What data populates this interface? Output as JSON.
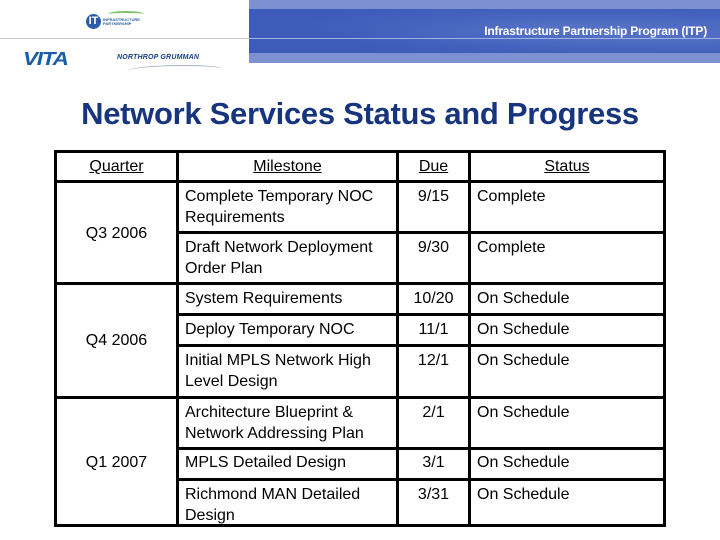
{
  "header": {
    "program_title": "Infrastructure Partnership Program (ITP)",
    "logos": {
      "itp": {
        "mark": "IT",
        "text": "INFRASTRUCTURE PARTNERSHIP"
      },
      "vita": "VITA",
      "northrop": "NORTHROP GRUMMAN"
    }
  },
  "page_title": "Network Services Status and Progress",
  "table": {
    "columns": [
      "Quarter",
      "Milestone",
      "Due",
      "Status"
    ],
    "quarters": [
      "Q3 2006",
      "Q4 2006",
      "Q1 2007"
    ],
    "rows": [
      {
        "quarter": "Q3 2006",
        "milestone": "Complete Temporary NOC Requirements",
        "due": "9/15",
        "status": "Complete"
      },
      {
        "quarter": "Q3 2006",
        "milestone": "Draft Network Deployment Order Plan",
        "due": "9/30",
        "status": "Complete"
      },
      {
        "quarter": "Q4 2006",
        "milestone": "System Requirements",
        "due": "10/20",
        "status": "On Schedule"
      },
      {
        "quarter": "Q4 2006",
        "milestone": "Deploy Temporary NOC",
        "due": "11/1",
        "status": "On Schedule"
      },
      {
        "quarter": "Q4 2006",
        "milestone": "Initial MPLS Network High Level Design",
        "due": "12/1",
        "status": "On Schedule"
      },
      {
        "quarter": "Q1 2007",
        "milestone": "Architecture Blueprint & Network Addressing Plan",
        "due": "2/1",
        "status": "On Schedule"
      },
      {
        "quarter": "Q1 2007",
        "milestone": "MPLS Detailed Design",
        "due": "3/1",
        "status": "On Schedule"
      },
      {
        "quarter": "Q1 2007",
        "milestone": "Richmond MAN Detailed Design",
        "due": "3/31",
        "status": "On Schedule"
      }
    ]
  },
  "colors": {
    "title": "#17357f",
    "banner": "#3d5cba",
    "banner_light": "#7d90cf"
  }
}
